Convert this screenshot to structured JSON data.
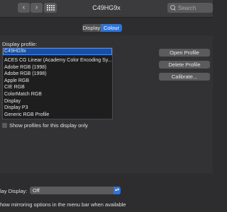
{
  "window": {
    "title": "C49HG9x",
    "back_glyph": "‹",
    "forward_glyph": "›",
    "search_placeholder": "Search"
  },
  "tabs": [
    {
      "label": "Display",
      "active": false
    },
    {
      "label": "Colour",
      "active": true
    }
  ],
  "profile_section": {
    "label": "Display profile:",
    "items": [
      "C49HG9x",
      "ACES CG Linear (Academy Color Encoding Sy...",
      "Adobe RGB (1998)",
      "Adobe RGB (1998)",
      "Apple RGB",
      "CIE RGB",
      "ColorMatch RGB",
      "Display",
      "Display P3",
      "Generic RGB Profile"
    ],
    "selected_index": 0
  },
  "buttons": {
    "open_profile": "Open Profile",
    "delete_profile": "Delete Profile",
    "calibrate": "Calibrate..."
  },
  "show_profiles_checkbox": {
    "label": "Show profiles for this display only",
    "checked": false
  },
  "airplay": {
    "label": "lay Display:",
    "value": "Off"
  },
  "mirroring": {
    "label": "how mirroring options in the menu bar when available"
  },
  "colors": {
    "accent": "#2f74d8",
    "selection": "#1a4ea3",
    "background": "#2d2d2f"
  }
}
